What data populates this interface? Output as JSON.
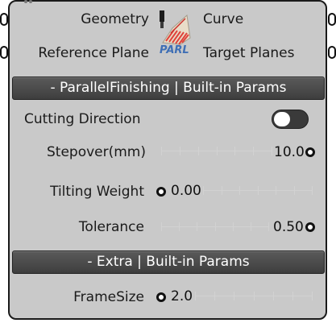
{
  "component": {
    "inputs": [
      "Geometry",
      "Reference Plane"
    ],
    "outputs": [
      "Curve",
      "Target Planes"
    ],
    "logo_text": "PARL",
    "colors": {
      "panel": "#c9c9c9",
      "header": "#474747",
      "logo_accent": "#e0443c",
      "logo_blue": "#3f6fb5"
    }
  },
  "sections": {
    "parallel": {
      "header": "- ParallelFinishing | Built-in Params",
      "cutting_direction": {
        "label": "Cutting Direction",
        "value": false
      },
      "stepover": {
        "label": "Stepover(mm)",
        "value": "10.0",
        "fraction": 1.0
      },
      "tilting_weight": {
        "label": "Tilting Weight",
        "value": "0.00",
        "fraction": 0.0
      },
      "tolerance": {
        "label": "Tolerance",
        "value": "0.50",
        "fraction": 1.0
      }
    },
    "extra": {
      "header": "- Extra | Built-in Params",
      "frame_size": {
        "label": "FrameSize",
        "value": "2.0",
        "fraction": 0.0
      }
    }
  }
}
